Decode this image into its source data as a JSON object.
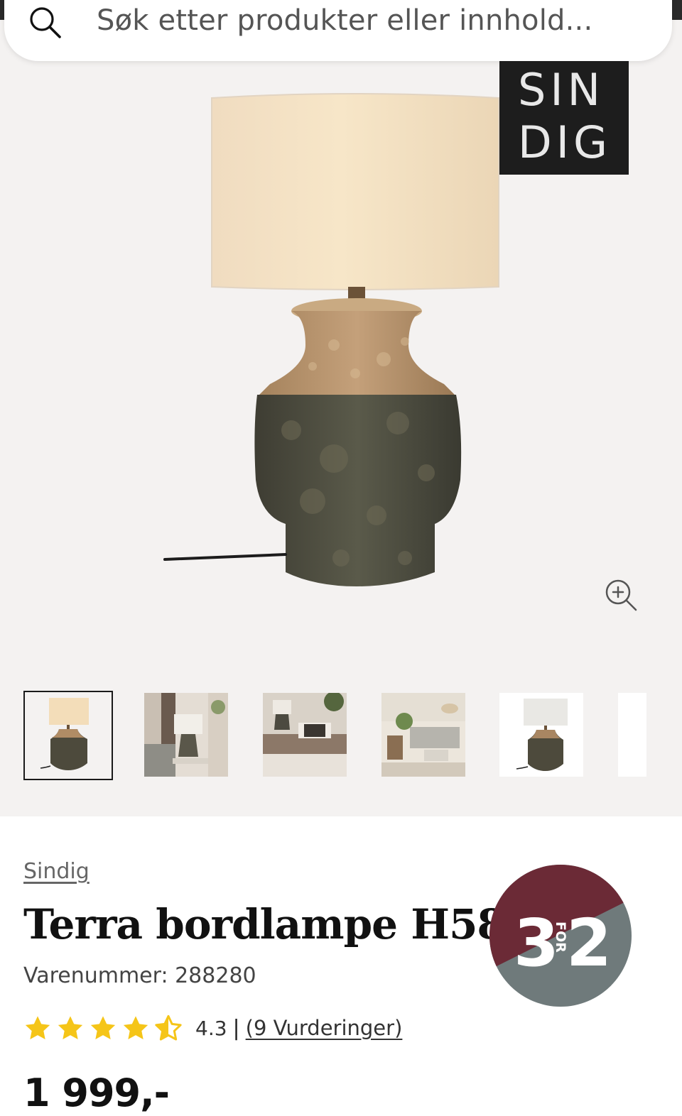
{
  "search": {
    "placeholder": "Søk etter produkter eller innhold..."
  },
  "gallery": {
    "brand_logo": {
      "row1": "SIN",
      "row2": "DIG"
    },
    "thumbnails": [
      "lamp-front",
      "living-room",
      "bedroom",
      "lounge",
      "lamp-white-shade"
    ],
    "active_thumbnail": 0
  },
  "product": {
    "brand": "Sindig",
    "title": "Terra bordlampe H58",
    "sku_label": "Varenummer: 288280",
    "rating": {
      "value": "4.3",
      "stars": 4.3,
      "separator": "|",
      "reviews_text": "(9 Vurderinger)"
    },
    "price": "1 999,-"
  },
  "promo": {
    "left": "3",
    "middle": "FOR",
    "right": "2",
    "color_top": "#6b2a36",
    "color_bottom": "#6f7a7b"
  },
  "colors": {
    "star": "#f5c518",
    "background": "#f4f2f1"
  }
}
